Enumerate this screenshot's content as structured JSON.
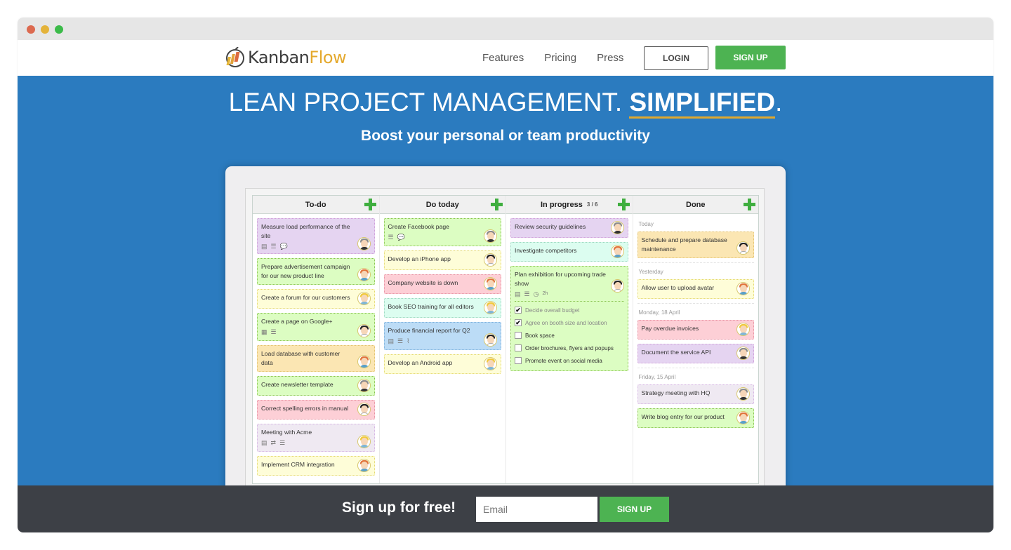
{
  "browser": {
    "window_controls": [
      "close",
      "minimize",
      "maximize"
    ]
  },
  "nav": {
    "logo": {
      "brand_part1": "Kanban",
      "brand_part2": "Flow",
      "icon": "kanbanflow-logo-icon"
    },
    "links": [
      "Features",
      "Pricing",
      "Press"
    ],
    "login_label": "LOGIN",
    "signup_label": "SIGN UP"
  },
  "hero": {
    "title_main": "LEAN PROJECT MANAGEMENT. ",
    "title_emphasis": "SIMPLIFIED",
    "title_period": ".",
    "subtitle": "Boost your personal or team productivity"
  },
  "board": {
    "columns": [
      {
        "title": "To-do",
        "wip": "",
        "cards": [
          {
            "text": "Measure load performance of the site",
            "color": "purple",
            "icons": [
              "description-icon",
              "subtasks-icon",
              "comment-icon"
            ],
            "avatar": "gray"
          },
          {
            "text": "Prepare advertisement campaign for our new product line",
            "color": "green",
            "icons": [],
            "avatar": "red"
          },
          {
            "text": "Create a forum for our customers",
            "color": "yellow",
            "icons": [],
            "avatar": "blond"
          },
          {
            "text": "Create a page on Google+",
            "color": "green",
            "icons": [
              "calendar-icon",
              "subtasks-icon"
            ],
            "avatar": "black"
          },
          {
            "text": "Load database with customer data",
            "color": "orange",
            "icons": [],
            "avatar": "red"
          },
          {
            "text": "Create newsletter template",
            "color": "green",
            "icons": [],
            "avatar": "gray"
          },
          {
            "text": "Correct spelling errors in manual",
            "color": "pink",
            "icons": [],
            "avatar": "black"
          },
          {
            "text": "Meeting with Acme",
            "color": "lavender",
            "icons": [
              "description-icon",
              "recurring-icon",
              "subtasks-icon"
            ],
            "avatar": "blond"
          },
          {
            "text": "Implement CRM integration",
            "color": "yellow",
            "icons": [],
            "avatar": "red"
          }
        ]
      },
      {
        "title": "Do today",
        "wip": "",
        "cards": [
          {
            "text": "Create Facebook page",
            "color": "green",
            "icons": [
              "subtasks-icon",
              "comment-icon"
            ],
            "avatar": "gray"
          },
          {
            "text": "Develop an iPhone app",
            "color": "yellow",
            "icons": [],
            "avatar": "black"
          },
          {
            "text": "Company website is down",
            "color": "pink",
            "icons": [],
            "avatar": "red"
          },
          {
            "text": "Book SEO training for all editors",
            "color": "cyan",
            "icons": [],
            "avatar": "blond"
          },
          {
            "text": "Produce financial report for Q2",
            "color": "blue",
            "icons": [
              "description-icon",
              "subtasks-icon",
              "attachment-icon"
            ],
            "avatar": "black"
          },
          {
            "text": "Develop an Android app",
            "color": "yellow",
            "icons": [],
            "avatar": "blond"
          }
        ]
      },
      {
        "title": "In progress",
        "wip": "3 / 6",
        "cards": [
          {
            "text": "Review security guidelines",
            "color": "purple",
            "icons": [],
            "avatar": "gray"
          },
          {
            "text": "Investigate competitors",
            "color": "cyan",
            "icons": [],
            "avatar": "red"
          },
          {
            "text": "Plan exhibition for upcoming trade show",
            "color": "green",
            "icons": [
              "description-icon",
              "subtasks-icon",
              "clock-icon"
            ],
            "time": "2h",
            "avatar": "black",
            "checklist": [
              {
                "label": "Decide overall budget",
                "done": true
              },
              {
                "label": "Agree on booth size and location",
                "done": true
              },
              {
                "label": "Book space",
                "done": false
              },
              {
                "label": "Order brochures, flyers and popups",
                "done": false
              },
              {
                "label": "Promote event on social media",
                "done": false
              }
            ]
          }
        ]
      },
      {
        "title": "Done",
        "wip": "",
        "groups": [
          {
            "label": "Today",
            "cards": [
              {
                "text": "Schedule and prepare database maintenance",
                "color": "orange",
                "avatar": "black"
              }
            ]
          },
          {
            "label": "Yesterday",
            "cards": [
              {
                "text": "Allow user to upload avatar",
                "color": "yellow",
                "avatar": "red"
              }
            ]
          },
          {
            "label": "Monday, 18 April",
            "cards": [
              {
                "text": "Pay overdue invoices",
                "color": "pink",
                "avatar": "blond"
              },
              {
                "text": "Document the service API",
                "color": "purple",
                "avatar": "gray"
              }
            ]
          },
          {
            "label": "Friday, 15 April",
            "cards": [
              {
                "text": "Strategy meeting with HQ",
                "color": "lavender",
                "avatar": "gray"
              },
              {
                "text": "Write blog entry for our product",
                "color": "green",
                "avatar": "red"
              }
            ]
          }
        ]
      }
    ]
  },
  "footer": {
    "cta_text": "Sign up for free!",
    "email_placeholder": "Email",
    "email_value": "",
    "signup_label": "SIGN UP"
  },
  "colors": {
    "hero_blue": "#2b7bbf",
    "accent_green": "#4db352",
    "accent_gold": "#e0a82e",
    "footer_dark": "#3d4046"
  }
}
